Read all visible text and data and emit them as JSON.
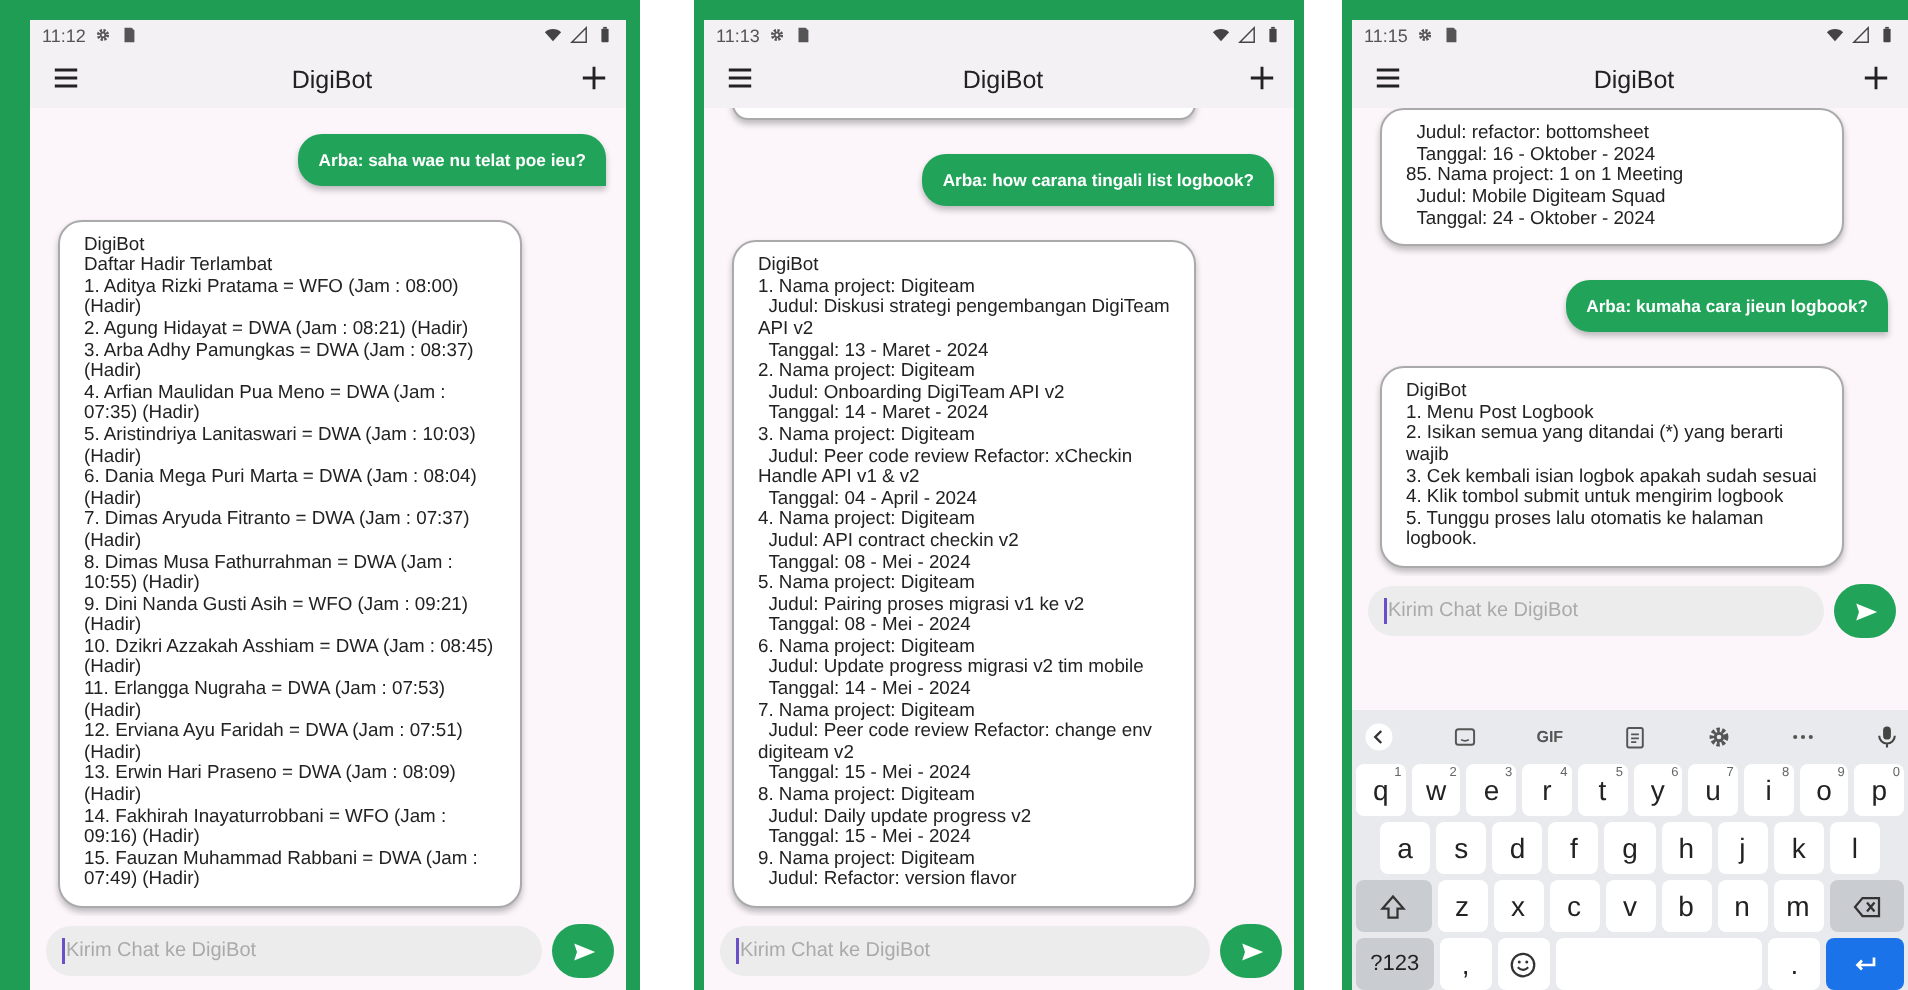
{
  "phones": [
    {
      "status": {
        "time": "11:12"
      },
      "app_bar": {
        "title": "DigiBot"
      },
      "messages": [
        {
          "kind": "user",
          "text": "Arba: saha wae nu telat poe ieu?"
        },
        {
          "kind": "bot",
          "sender": "DigiBot",
          "lines": [
            "Daftar Hadir Terlambat",
            "1. Aditya Rizki Pratama = WFO (Jam : 08:00) (Hadir)",
            "2. Agung Hidayat = DWA (Jam : 08:21) (Hadir)",
            "3. Arba Adhy Pamungkas = DWA (Jam : 08:37) (Hadir)",
            "4. Arfian Maulidan Pua Meno = DWA (Jam : 07:35) (Hadir)",
            "5. Aristindriya Lanitaswari = DWA (Jam : 10:03) (Hadir)",
            "6. Dania Mega Puri Marta = DWA (Jam : 08:04) (Hadir)",
            "7. Dimas Aryuda Fitranto = DWA (Jam : 07:37) (Hadir)",
            "8. Dimas Musa Fathurrahman = DWA (Jam : 10:55) (Hadir)",
            "9. Dini Nanda Gusti Asih = WFO (Jam : 09:21) (Hadir)",
            "10. Dzikri Azzakah Asshiam = DWA (Jam : 08:45) (Hadir)",
            "11. Erlangga Nugraha = DWA (Jam : 07:53) (Hadir)",
            "12. Erviana Ayu Faridah = DWA (Jam : 07:51) (Hadir)",
            "13. Erwin Hari Praseno = DWA (Jam : 08:09) (Hadir)",
            "14. Fakhirah Inayaturrobbani = WFO (Jam : 09:16) (Hadir)",
            "15. Fauzan Muhammad Rabbani = DWA (Jam : 07:49) (Hadir)"
          ]
        }
      ],
      "input": {
        "placeholder": "Kirim Chat ke DigiBot"
      }
    },
    {
      "status": {
        "time": "11:13"
      },
      "app_bar": {
        "title": "DigiBot"
      },
      "messages": [
        {
          "kind": "bot"
        },
        {
          "kind": "user",
          "text": "Arba: how carana tingali list logbook?"
        },
        {
          "kind": "bot",
          "sender": "DigiBot",
          "lines": [
            "1. Nama project: Digiteam",
            "  Judul: Diskusi strategi pengembangan DigiTeam API v2",
            "  Tanggal: 13 - Maret - 2024",
            "2. Nama project: Digiteam",
            "  Judul: Onboarding DigiTeam API v2",
            "  Tanggal: 14 - Maret - 2024",
            "3. Nama project: Digiteam",
            "  Judul: Peer code review Refactor: xCheckin Handle API v1 & v2",
            "  Tanggal: 04 - April - 2024",
            "4. Nama project: Digiteam",
            "  Judul: API contract checkin v2",
            "  Tanggal: 08 - Mei - 2024",
            "5. Nama project: Digiteam",
            "  Judul: Pairing proses migrasi v1 ke v2",
            "  Tanggal: 08 - Mei - 2024",
            "6. Nama project: Digiteam",
            "  Judul: Update progress migrasi v2 tim mobile",
            "  Tanggal: 14 - Mei - 2024",
            "7. Nama project: Digiteam",
            "  Judul: Peer code review Refactor: change env digiteam v2",
            "  Tanggal: 15 - Mei - 2024",
            "8. Nama project: Digiteam",
            "  Judul: Daily update progress v2",
            "  Tanggal: 15 - Mei - 2024",
            "9. Nama project: Digiteam",
            "  Judul: Refactor: version flavor"
          ]
        }
      ],
      "input": {
        "placeholder": "Kirim Chat ke DigiBot"
      }
    },
    {
      "status": {
        "time": "11:15"
      },
      "app_bar": {
        "title": "DigiBot"
      },
      "messages": [
        {
          "kind": "bot",
          "lines": [
            "  Judul: refactor: bottomsheet",
            "  Tanggal: 16 - Oktober - 2024",
            "85. Nama project: 1 on 1 Meeting",
            "  Judul: Mobile Digiteam Squad",
            "  Tanggal: 24 - Oktober - 2024"
          ]
        },
        {
          "kind": "user",
          "text": "Arba: kumaha cara jieun logbook?"
        },
        {
          "kind": "bot",
          "sender": "DigiBot",
          "lines": [
            "1. Menu Post Logbook",
            "2. Isikan semua yang ditandai (*) yang berarti wajib",
            "3. Cek kembali isian logbok apakah sudah sesuai",
            "4. Klik tombol submit untuk mengirim logbook",
            "5. Tunggu proses lalu otomatis ke halaman logbook."
          ]
        }
      ],
      "input": {
        "placeholder": "Kirim Chat ke DigiBot"
      },
      "keyboard": {
        "toolbar": [
          {
            "kind": "back"
          },
          {
            "kind": "sticker"
          },
          {
            "kind": "text",
            "label": "GIF"
          },
          {
            "kind": "clipboard"
          },
          {
            "kind": "settings"
          },
          {
            "kind": "more"
          },
          {
            "kind": "mic"
          }
        ],
        "rows": [
          {
            "keys": [
              {
                "kind": "char",
                "label": "q",
                "hint": "1"
              },
              {
                "kind": "char",
                "label": "w",
                "hint": "2"
              },
              {
                "kind": "char",
                "label": "e",
                "hint": "3"
              },
              {
                "kind": "char",
                "label": "r",
                "hint": "4"
              },
              {
                "kind": "char",
                "label": "t",
                "hint": "5"
              },
              {
                "kind": "char",
                "label": "y",
                "hint": "6"
              },
              {
                "kind": "char",
                "label": "u",
                "hint": "7"
              },
              {
                "kind": "char",
                "label": "i",
                "hint": "8"
              },
              {
                "kind": "char",
                "label": "o",
                "hint": "9"
              },
              {
                "kind": "char",
                "label": "p",
                "hint": "0"
              }
            ]
          },
          {
            "keys": [
              {
                "kind": "char",
                "label": "a"
              },
              {
                "kind": "char",
                "label": "s"
              },
              {
                "kind": "char",
                "label": "d"
              },
              {
                "kind": "char",
                "label": "f"
              },
              {
                "kind": "char",
                "label": "g"
              },
              {
                "kind": "char",
                "label": "h"
              },
              {
                "kind": "char",
                "label": "j"
              },
              {
                "kind": "char",
                "label": "k"
              },
              {
                "kind": "char",
                "label": "l"
              }
            ]
          },
          {
            "keys": [
              {
                "kind": "shift"
              },
              {
                "kind": "char",
                "label": "z"
              },
              {
                "kind": "char",
                "label": "x"
              },
              {
                "kind": "char",
                "label": "c"
              },
              {
                "kind": "char",
                "label": "v"
              },
              {
                "kind": "char",
                "label": "b"
              },
              {
                "kind": "char",
                "label": "n"
              },
              {
                "kind": "char",
                "label": "m"
              },
              {
                "kind": "backspace"
              }
            ]
          },
          {
            "keys": [
              {
                "kind": "mode",
                "label": "?123"
              },
              {
                "kind": "char",
                "label": ","
              },
              {
                "kind": "emoji"
              },
              {
                "kind": "space"
              },
              {
                "kind": "char",
                "label": "."
              },
              {
                "kind": "enter"
              }
            ]
          }
        ]
      }
    }
  ]
}
